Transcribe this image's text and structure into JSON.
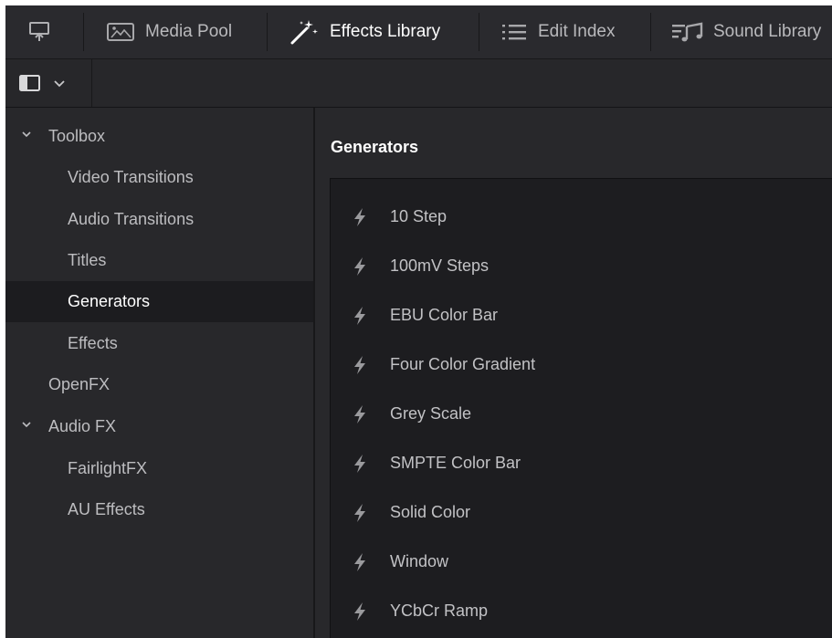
{
  "toolbar": {
    "tabs": [
      {
        "label": "Media Pool",
        "icon": "image-icon"
      },
      {
        "label": "Effects Library",
        "icon": "magic-wand-icon"
      },
      {
        "label": "Edit Index",
        "icon": "list-icon"
      },
      {
        "label": "Sound Library",
        "icon": "music-list-icon"
      }
    ],
    "active": "Effects Library"
  },
  "sidebar": {
    "items": [
      {
        "label": "Toolbox",
        "expanded": true
      },
      {
        "label": "Video Transitions"
      },
      {
        "label": "Audio Transitions"
      },
      {
        "label": "Titles"
      },
      {
        "label": "Generators",
        "selected": true
      },
      {
        "label": "Effects"
      },
      {
        "label": "OpenFX"
      },
      {
        "label": "Audio FX",
        "expanded": true
      },
      {
        "label": "FairlightFX"
      },
      {
        "label": "AU Effects"
      }
    ]
  },
  "main": {
    "title": "Generators",
    "items": [
      "10 Step",
      "100mV Steps",
      "EBU Color Bar",
      "Four Color Gradient",
      "Grey Scale",
      "SMPTE Color Bar",
      "Solid Color",
      "Window",
      "YCbCr Ramp"
    ]
  },
  "colors": {
    "background": "#1d1d20",
    "panel": "#28282b",
    "selected": "#1c1c1f",
    "text": "#c6c6c6"
  }
}
